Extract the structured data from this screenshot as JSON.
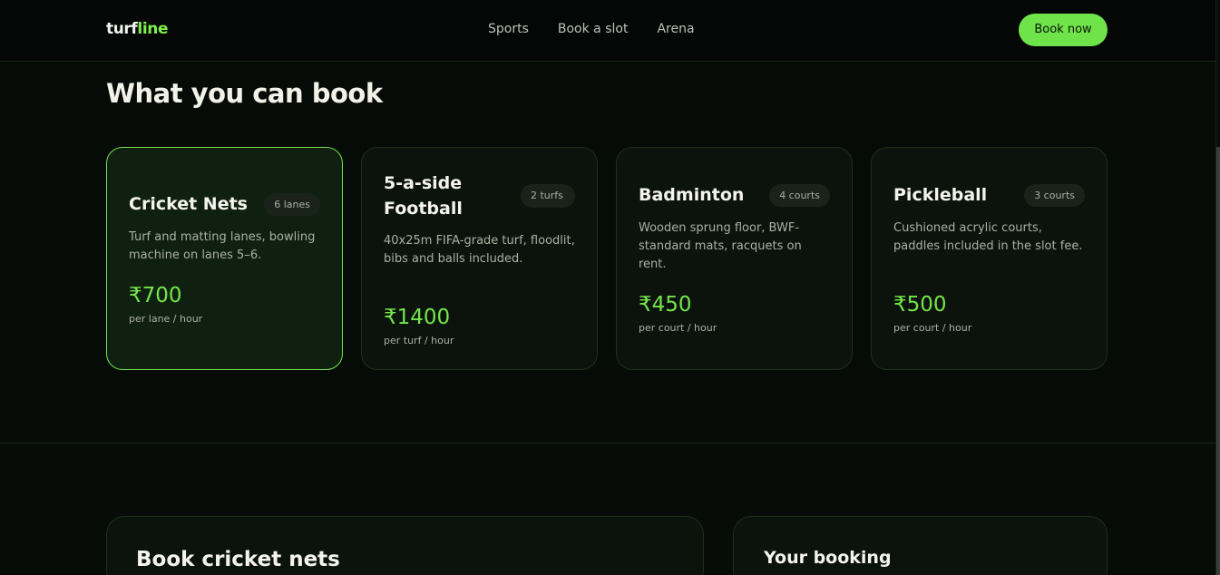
{
  "header": {
    "logo_main": "turf",
    "logo_accent": "line",
    "nav": [
      "Sports",
      "Book a slot",
      "Arena"
    ],
    "cta": "Book now"
  },
  "section": {
    "title": "What you can book",
    "cards": [
      {
        "title": "Cricket Nets",
        "badge": "6 lanes",
        "desc": "Turf and matting lanes, bowling machine on lanes 5–6.",
        "price": "₹700",
        "unit": "per lane / hour",
        "selected": true
      },
      {
        "title": "5-a-side Football",
        "badge": "2 turfs",
        "desc": "40x25m FIFA-grade turf, floodlit, bibs and balls included.",
        "price": "₹1400",
        "unit": "per turf / hour",
        "selected": false
      },
      {
        "title": "Badminton",
        "badge": "4 courts",
        "desc": "Wooden sprung floor, BWF-standard mats, racquets on rent.",
        "price": "₹450",
        "unit": "per court / hour",
        "selected": false
      },
      {
        "title": "Pickleball",
        "badge": "3 courts",
        "desc": "Cushioned acrylic courts, paddles included in the slot fee.",
        "price": "₹500",
        "unit": "per court / hour",
        "selected": false
      }
    ]
  },
  "booking": {
    "form_title": "Book cricket nets",
    "summary_title": "Your booking"
  },
  "colors": {
    "accent": "#74e64a",
    "background": "#070b08",
    "card": "#0c130d"
  }
}
